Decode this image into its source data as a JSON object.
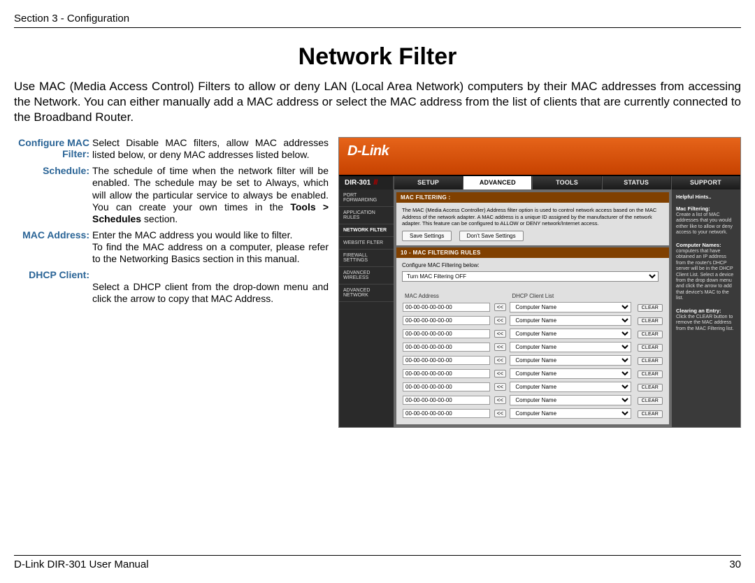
{
  "header": {
    "section": "Section 3 - Configuration"
  },
  "title": "Network Filter",
  "intro": "Use MAC (Media Access Control) Filters to allow or deny LAN (Local Area Network) computers by their MAC addresses from accessing the Network. You can either manually add a MAC address or select the MAC address from the list of clients that are currently connected to the Broadband Router.",
  "terms": [
    {
      "label": "Configure MAC Filter:",
      "label_lines": [
        "Configure MAC",
        "Filter:"
      ],
      "def": "Select Disable MAC filters, allow MAC addresses listed below, or deny MAC addresses listed below."
    },
    {
      "label": "Schedule:",
      "def_pre": "The schedule of time when the network filter will be enabled. The schedule may be set to Always, which will allow the particular service to always be enabled. You can create your own times in the ",
      "def_bold": "Tools > Schedules",
      "def_post": " section."
    },
    {
      "label": "MAC Address:",
      "def": "Enter the MAC address you would like to filter.",
      "def2": "To find the MAC address on a computer, please refer to the Networking Basics section in this manual."
    },
    {
      "label": "DHCP Client:",
      "def3": "Select a DHCP client from the drop-down menu and click the arrow to copy that MAC Address."
    }
  ],
  "router": {
    "brand": "D-Link",
    "model": "DIR-301",
    "tabs": [
      "SETUP",
      "ADVANCED",
      "TOOLS",
      "STATUS",
      "SUPPORT"
    ],
    "tab_active": 1,
    "side": [
      "PORT FORWARDING",
      "APPLICATION RULES",
      "NETWORK FILTER",
      "WEBSITE FILTER",
      "FIREWALL SETTINGS",
      "ADVANCED WIRELESS",
      "ADVANCED NETWORK"
    ],
    "side_active": 2,
    "sec1_title": "MAC FILTERING :",
    "sec1_text": "The MAC (Media Access Controller) Address filter option is used to control network access based on the MAC Address of the network adapter. A MAC address is a unique ID assigned by the manufacturer of the network adapter. This feature can be configured to ALLOW or DENY network/Internet access.",
    "btn_save": "Save Settings",
    "btn_nosave": "Don't Save Settings",
    "sec2_title": "10 - MAC FILTERING RULES",
    "cfg_label": "Configure MAC Filtering below:",
    "cfg_select": "Turn MAC Filtering OFF",
    "col_mac": "MAC Address",
    "col_dhcp": "DHCP Client List",
    "row_mac": "00-00-00-00-00-00",
    "row_copy": "<<",
    "row_client": "Computer Name",
    "row_clear": "CLEAR",
    "rows": 9,
    "hints_title": "Helpful Hints..",
    "hints": [
      {
        "h": "Mac Filtering:",
        "t": "Create a list of MAC addresses that you would either like to allow or deny access to your network."
      },
      {
        "h": "Computer Names:",
        "t": "computers that have obtained an IP address from the router's DHCP server will be in the DHCP Client List. Select a device from the drop down menu and click the arrow to add that device's MAC to the list."
      },
      {
        "h": "Clearing an Entry:",
        "t": "Click the CLEAR button to remove the MAC address from the MAC Filtering list."
      }
    ]
  },
  "footer": {
    "left": "D-Link DIR-301 User Manual",
    "right": "30"
  }
}
